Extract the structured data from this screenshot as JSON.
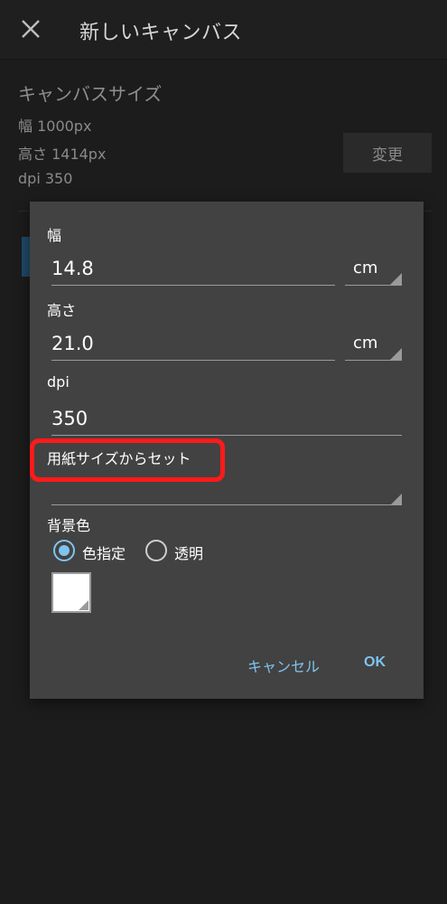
{
  "appbar": {
    "title": "新しいキャンバス",
    "close_icon": "close-icon"
  },
  "canvas_info": {
    "section_title": "キャンバスサイズ",
    "width_line": "幅 1000px",
    "height_line": "高さ 1414px",
    "dpi_line": "dpi 350",
    "change_label": "変更"
  },
  "dialog": {
    "width": {
      "label": "幅",
      "value": "14.8",
      "unit": "cm"
    },
    "height": {
      "label": "高さ",
      "value": "21.0",
      "unit": "cm"
    },
    "dpi": {
      "label": "dpi",
      "value": "350"
    },
    "paper_size_label": "用紙サイズからセット",
    "background": {
      "label": "背景色",
      "options": [
        {
          "label": "色指定",
          "selected": true
        },
        {
          "label": "透明",
          "selected": false
        }
      ],
      "swatch_color": "#ffffff"
    },
    "cancel_label": "キャンセル",
    "ok_label": "OK"
  },
  "colors": {
    "accent": "#7fc4ee",
    "highlight": "#ff1a1a",
    "dialog_bg": "#424242",
    "page_bg": "#1c1c1c"
  }
}
